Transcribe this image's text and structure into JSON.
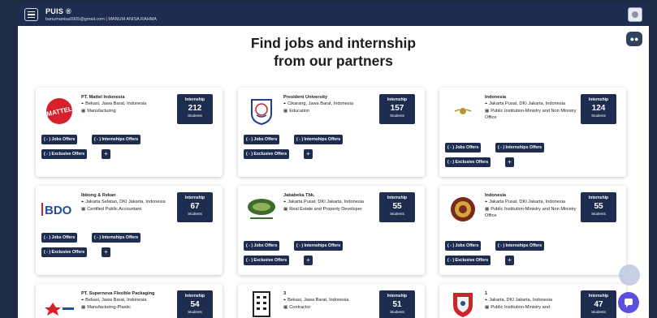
{
  "header": {
    "app_title": "PUIS ®",
    "user_line": "banumanisa0905@gmail.com | MANUM ANISA RAHMA"
  },
  "page": {
    "heading_line1": "Find jobs and internship",
    "heading_line2": "from our partners"
  },
  "buttons": {
    "jobs": "( - ) Jobs Offers",
    "internships": "( - ) Internships Offers",
    "exclusive": "( - ) Exclusive Offers",
    "plus": "+"
  },
  "stat_labels": {
    "type": "Internship",
    "unit": "Students"
  },
  "partners": [
    {
      "name": "PT. Mattel Indonesia",
      "location": "Bekasi, Jawa Barat, Indonesia",
      "industry": "Manufacturing",
      "count": "212",
      "logo": "mattel-logo"
    },
    {
      "name": "President University",
      "location": "Cikarang, Jawa Barat, Indonesia",
      "industry": "Education",
      "count": "157",
      "logo": "president-university-logo"
    },
    {
      "name": "Indonesia",
      "location": "Jakarta Pusat, DKI Jakarta, Indonesia",
      "industry": "Public Institution-Ministry and Non Ministry Office",
      "count": "124",
      "logo": "ministry-logo"
    },
    {
      "name": "Ibbong & Rekan",
      "location": "Jakarta Selatan, DKI Jakarta, Indonesia",
      "industry": "Certified Public Accountant",
      "count": "67",
      "logo": "bdo-logo"
    },
    {
      "name": "Jababeka Tbk.",
      "location": "Jakarta Pusat, DKI Jakarta, Indonesia",
      "industry": "Real Estate and Property Developer",
      "count": "55",
      "logo": "jababeka-logo"
    },
    {
      "name": "Indonesia",
      "location": "Jakarta Pusat, DKI Jakarta, Indonesia",
      "industry": "Public Institution-Ministry and Non Ministry Office",
      "count": "55",
      "logo": "emblem-logo"
    },
    {
      "name": "PT. Supernova Flexible Packaging",
      "location": "Bekasi, Jawa Barat, Indonesia",
      "industry": "Manufacturing-Plastic",
      "count": "54",
      "logo": "supernova-logo"
    },
    {
      "name": "3",
      "location": "Bekasi, Jawa Barat, Indonesia",
      "industry": "Contractor",
      "count": "51",
      "logo": "building-logo"
    },
    {
      "name": "1",
      "location": "Jakarta, DKI Jakarta, Indonesia",
      "industry": "Public Institution-Ministry and",
      "count": "47",
      "logo": "shield-logo"
    }
  ],
  "colors": {
    "navy": "#1e2d4f",
    "backdrop": "#1f2a44",
    "chat_fab": "#5b4fe0"
  }
}
